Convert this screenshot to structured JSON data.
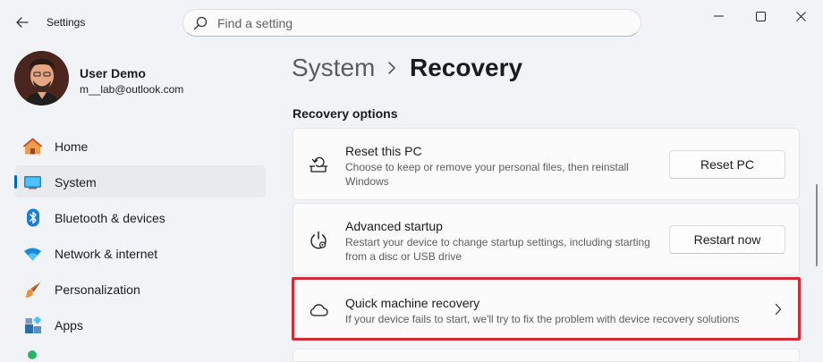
{
  "app": {
    "title": "Settings"
  },
  "search": {
    "placeholder": "Find a setting"
  },
  "user": {
    "name": "User Demo",
    "email": "m__lab@outlook.com"
  },
  "nav": {
    "items": [
      {
        "label": "Home",
        "icon": "home-icon"
      },
      {
        "label": "System",
        "icon": "system-icon",
        "active": true
      },
      {
        "label": "Bluetooth & devices",
        "icon": "bluetooth-icon"
      },
      {
        "label": "Network & internet",
        "icon": "wifi-icon"
      },
      {
        "label": "Personalization",
        "icon": "brush-icon"
      },
      {
        "label": "Apps",
        "icon": "apps-icon"
      }
    ]
  },
  "breadcrumb": {
    "parent": "System",
    "current": "Recovery"
  },
  "section": {
    "title": "Recovery options"
  },
  "cards": [
    {
      "title": "Reset this PC",
      "description": "Choose to keep or remove your personal files, then reinstall Windows",
      "button": "Reset PC",
      "icon": "reset-pc-icon"
    },
    {
      "title": "Advanced startup",
      "description": "Restart your device to change startup settings, including starting from a disc or USB drive",
      "button": "Restart now",
      "icon": "advanced-startup-icon"
    },
    {
      "title": "Quick machine recovery",
      "description": "If your device fails to start, we'll try to fix the problem with device recovery solutions",
      "icon": "cloud-icon"
    }
  ],
  "colors": {
    "accent": "#0067c0",
    "highlight": "#d42a35",
    "background": "#f1f3f6",
    "card": "#fbfbfb"
  }
}
